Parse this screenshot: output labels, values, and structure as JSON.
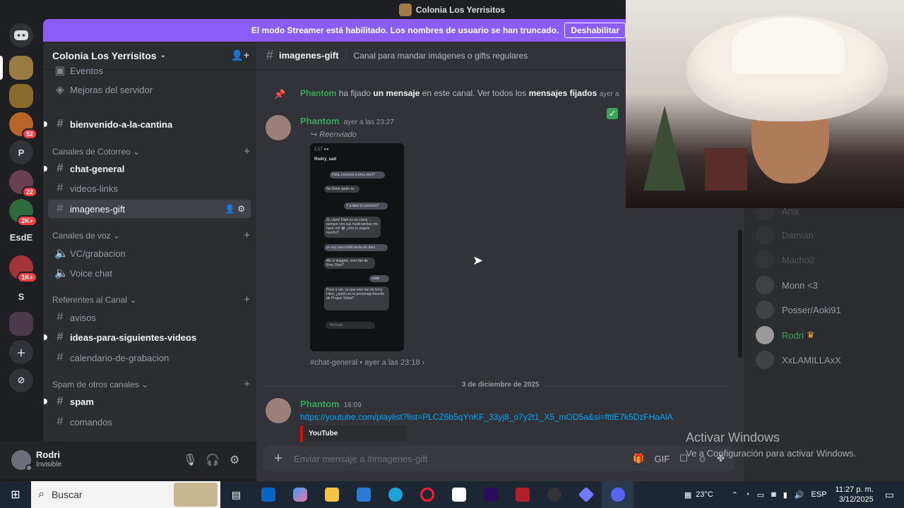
{
  "window": {
    "title": "Colonia Los Yerrisitos"
  },
  "streamer_banner": {
    "text": "El modo Streamer está habilitado. Los nombres de usuario se han truncado.",
    "button": "Deshabilitar"
  },
  "servers": [
    {
      "label": "",
      "badge": ""
    },
    {
      "label": "",
      "badge": ""
    },
    {
      "label": "",
      "badge": "52"
    },
    {
      "label": "P",
      "badge": ""
    },
    {
      "label": "",
      "badge": "22"
    },
    {
      "label": "",
      "badge": "2K+"
    },
    {
      "label": "EsdE",
      "badge": ""
    },
    {
      "label": "",
      "badge": "1K+"
    },
    {
      "label": "S",
      "badge": ""
    },
    {
      "label": "",
      "badge": ""
    }
  ],
  "sidebar": {
    "guild_name": "Colonia Los Yerrisitos",
    "top_items": [
      "Eventos",
      "Mejoras del servidor"
    ],
    "welcome_channel": "bienvenido-a-la-cantina",
    "categories": {
      "cotorreo": "Canales de Cotorreo",
      "voz": "Canales de voz",
      "referentes": "Referentes al Canal",
      "spam": "Spam de otros canales"
    },
    "channels": {
      "chat_general": "chat-general",
      "videos_links": "videos-links",
      "imagenes_gift": "imagenes-gift",
      "vc_grabacion": "VC/grabacion",
      "voice_chat": "Voice chat",
      "avisos": "avisos",
      "ideas": "ideas-para-siguientes-videos",
      "calendario": "calendario-de-grabacion",
      "spam": "spam",
      "comandos": "comandos"
    }
  },
  "user": {
    "name": "Rodri",
    "status": "Invisible"
  },
  "chat": {
    "channel": "imagenes-gift",
    "topic": "Canal para mandar imágenes o gifts regulares",
    "pin_notice": {
      "who": "Phantom",
      "a": "ha fijado",
      "b": "un mensaje",
      "c": "en este canal. Ver todos los",
      "d": "mensajes fijados",
      "time": "ayer a"
    },
    "message1": {
      "author": "Phantom",
      "time": "ayer a las 23:27",
      "forwarded": "Reenviado",
      "source": "#chat-general • ayer a las 23:18 ›"
    },
    "phone": {
      "contact": "Rodry_sad",
      "bubbles": [
        "Hola, conoces a emu otori?",
        "No\nDime quién es",
        "Y a dani lo conoces?",
        "Si, claro! Dani es un crack, aunque con sus multicuentas me hace reír 😂 ¿Vos lo seguís mucho?",
        "yo soy una multicuenta de dani",
        "Me lo imaginé, eres fan de Emu Otori?",
        "siiiiiiii",
        "Pues a ver, ya que eres fan de Emu Otori, ¿quién es tu personaje favorito de Project Sekai?"
      ],
      "input": "Mensaje"
    },
    "date_divider": "3 de diciembre de 2025",
    "message2": {
      "author": "Phantom",
      "time": "16:09",
      "link": "https://youtube.com/playlist?list=PLCZ6b5qYnKF_33yj8_o7y2t1_X5_mOD5a&si=fttlE7k5DzFHaAlA",
      "embed": "YouTube"
    },
    "composer_placeholder": "Enviar mensaje a #imagenes-gift"
  },
  "members": [
    {
      "name": "Ana",
      "state": "dim"
    },
    {
      "name": "Damian",
      "state": "dim"
    },
    {
      "name": "Macho2",
      "state": "dim"
    },
    {
      "name": "Monn <3",
      "state": "offline"
    },
    {
      "name": "Posser/Aoki91",
      "state": "offline"
    },
    {
      "name": "Rodri",
      "state": "online",
      "crown": "♛"
    },
    {
      "name": "XxLAMILLAxX",
      "state": "offline"
    }
  ],
  "watermark": {
    "title": "Activar Windows",
    "subtitle": "Ve a Configuración para activar Windows."
  },
  "taskbar": {
    "search": "Buscar",
    "weather": "23°C",
    "lang": "ESP",
    "time": "11:27 p. m.",
    "date": "3/12/2025"
  },
  "colors": {
    "online": "#3ba55c",
    "link": "#00a8fc",
    "banner": "#8b5cf6",
    "badge": "#f23f43"
  }
}
